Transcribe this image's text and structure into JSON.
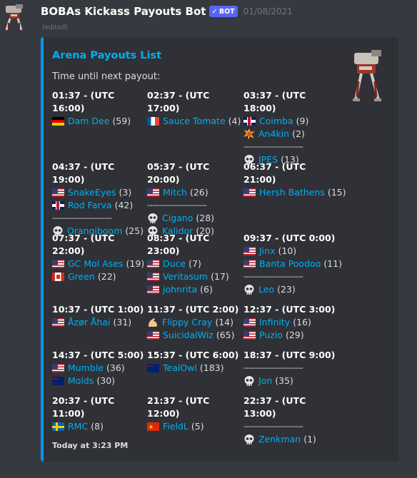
{
  "message": {
    "author": "BOBAs Kickass Payouts Bot",
    "bot_tag": "BOT",
    "date": "01/08/2021",
    "edited": "(edited)"
  },
  "embed": {
    "title": "Arena Payouts List",
    "description": "Time until next payout:",
    "footer": "Today at 3:23 PM",
    "accent_color": "#0096ff",
    "columns": [
      [
        {
          "name": "01:37 - (UTC 16:00)",
          "groups": [
            [
              {
                "icon": "flag-de",
                "player": "Dam Dee",
                "count": "(59)"
              }
            ]
          ]
        },
        {
          "name": "04:37 - (UTC 19:00)",
          "groups": [
            [
              {
                "icon": "flag-us",
                "player": "SnakeEyes",
                "count": "(3)"
              },
              {
                "icon": "flag-gb",
                "player": "Rod Farva",
                "count": "(42)"
              }
            ],
            [
              {
                "icon": "skull-icon",
                "player": "Orangiboom",
                "count": "(25)"
              }
            ]
          ]
        },
        {
          "name": "07:37 - (UTC 22:00)",
          "groups": [
            [
              {
                "icon": "flag-us",
                "player": "GC Mol Ases",
                "count": "(19)"
              },
              {
                "icon": "flag-ca",
                "player": "Green",
                "count": "(22)"
              }
            ]
          ]
        },
        {
          "name": "10:37 - (UTC 1:00)",
          "groups": [
            [
              {
                "icon": "flag-us",
                "player": "Åzør Åhai",
                "count": "(31)"
              }
            ]
          ]
        },
        {
          "name": "14:37 - (UTC 5:00)",
          "groups": [
            [
              {
                "icon": "flag-us",
                "player": "Mumble",
                "count": "(36)"
              },
              {
                "icon": "flag-au",
                "player": "Molds",
                "count": "(30)"
              }
            ]
          ]
        },
        {
          "name": "20:37 - (UTC 11:00)",
          "groups": [
            [
              {
                "icon": "flag-se",
                "player": "RMC",
                "count": "(8)"
              }
            ]
          ]
        }
      ],
      [
        {
          "name": "02:37 - (UTC 17:00)",
          "groups": [
            [
              {
                "icon": "flag-fr",
                "player": "Sauce Tomate",
                "count": "(4)"
              }
            ]
          ]
        },
        {
          "name": "05:37 - (UTC 20:00)",
          "groups": [
            [
              {
                "icon": "flag-us",
                "player": "Mitch",
                "count": "(26)"
              }
            ],
            [
              {
                "icon": "skull-icon",
                "player": "Cigano",
                "count": "(28)"
              },
              {
                "icon": "skull-icon",
                "player": "Kalidor",
                "count": "(20)"
              }
            ]
          ]
        },
        {
          "name": "08:37 - (UTC 23:00)",
          "groups": [
            [
              {
                "icon": "flag-us",
                "player": "Duce",
                "count": "(7)"
              },
              {
                "icon": "flag-us",
                "player": "Veritasum",
                "count": "(17)"
              },
              {
                "icon": "flag-us",
                "player": "johnrita",
                "count": "(6)"
              }
            ]
          ]
        },
        {
          "name": "11:37 - (UTC 2:00)",
          "groups": [
            [
              {
                "icon": "flexed-bicep-icon",
                "player": "Flippy Cray",
                "count": "(14)"
              },
              {
                "icon": "flag-us",
                "player": "SuicidalWiz",
                "count": "(65)"
              }
            ]
          ]
        },
        {
          "name": "15:37 - (UTC 6:00)",
          "groups": [
            [
              {
                "icon": "flag-au",
                "player": "TealOwl",
                "count": "(183)"
              }
            ]
          ]
        },
        {
          "name": "21:37 - (UTC 12:00)",
          "groups": [
            [
              {
                "icon": "flag-cn",
                "player": "FieldL",
                "count": "(5)"
              }
            ]
          ]
        }
      ],
      [
        {
          "name": "03:37 - (UTC 18:00)",
          "groups": [
            [
              {
                "icon": "flag-gb",
                "player": "Coimba",
                "count": "(9)"
              },
              {
                "icon": "collision-icon",
                "player": "An4kin",
                "count": "(2)"
              }
            ],
            [
              {
                "icon": "skull-icon",
                "player": "JPES",
                "count": "(13)"
              }
            ]
          ]
        },
        {
          "name": "06:37 - (UTC 21:00)",
          "groups": [
            [
              {
                "icon": "flag-us",
                "player": "Hersh Bathens",
                "count": "(15)"
              }
            ]
          ]
        },
        {
          "name": "09:37 - (UTC 0:00)",
          "groups": [
            [
              {
                "icon": "flag-us",
                "player": "Jinx",
                "count": "(10)"
              },
              {
                "icon": "flag-us",
                "player": "Banta Poodoo",
                "count": "(11)"
              }
            ],
            [
              {
                "icon": "skull-icon",
                "player": "Leo",
                "count": "(23)"
              }
            ]
          ]
        },
        {
          "name": "12:37 - (UTC 3:00)",
          "groups": [
            [
              {
                "icon": "flag-us",
                "player": "Infinity",
                "count": "(16)"
              },
              {
                "icon": "flag-us",
                "player": "Puzio",
                "count": "(29)"
              }
            ]
          ]
        },
        {
          "name": "18:37 - (UTC 9:00)",
          "groups": [
            [],
            [
              {
                "icon": "skull-icon",
                "player": "Jon",
                "count": "(35)"
              }
            ]
          ]
        },
        {
          "name": "22:37 - (UTC 13:00)",
          "groups": [
            [],
            [
              {
                "icon": "skull-icon",
                "player": "Zenkman",
                "count": "(1)"
              }
            ]
          ]
        }
      ]
    ],
    "separator": "------------------------"
  }
}
